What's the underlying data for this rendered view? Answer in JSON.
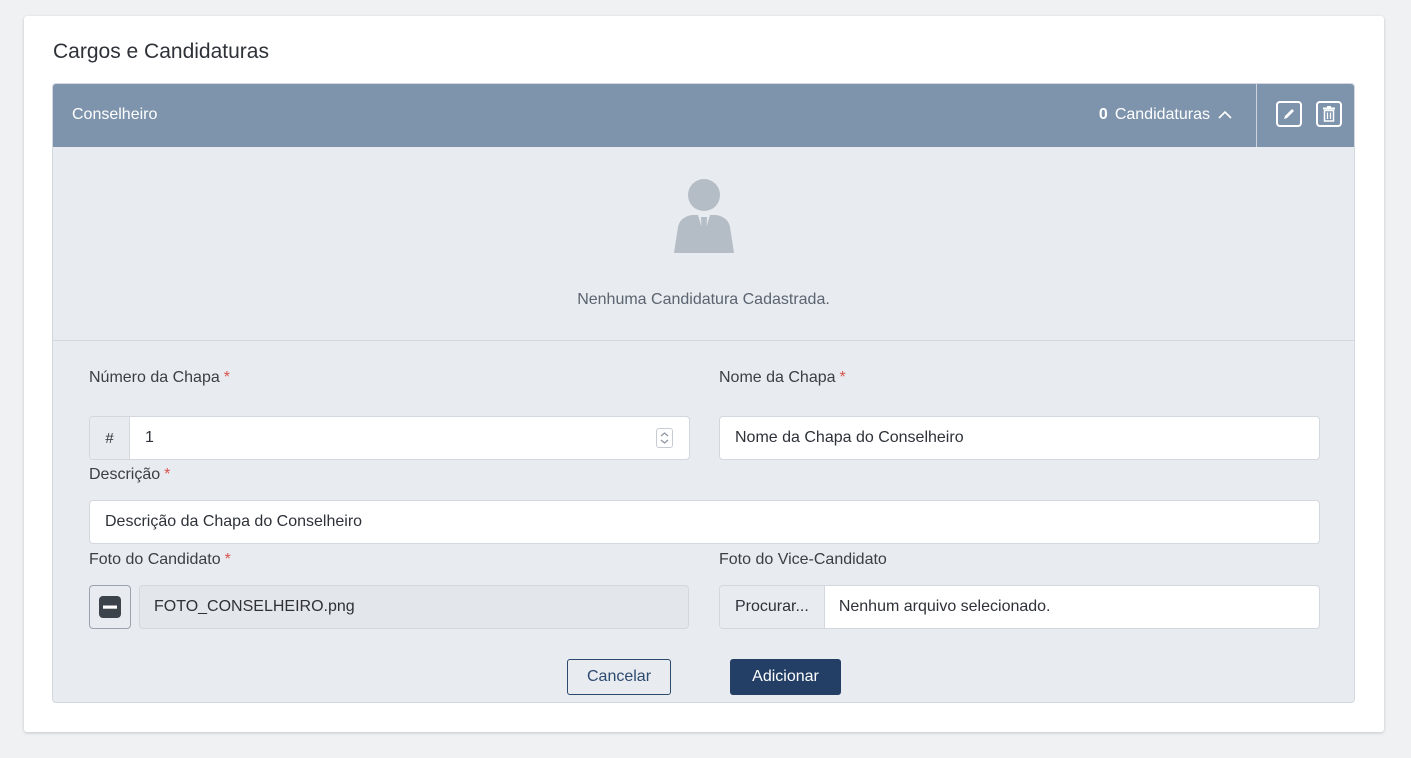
{
  "section": {
    "title": "Cargos e Candidaturas"
  },
  "cargo": {
    "name": "Conselheiro",
    "count": "0",
    "count_label": "Candidaturas",
    "empty_message": "Nenhuma Candidatura Cadastrada."
  },
  "form": {
    "numero": {
      "label": "Número da Chapa",
      "required": "*",
      "prefix": "#",
      "value": "1"
    },
    "nome": {
      "label": "Nome da Chapa",
      "required": "*",
      "value": "Nome da Chapa do Conselheiro"
    },
    "descricao": {
      "label": "Descrição",
      "required": "*",
      "value": "Descrição da Chapa do Conselheiro"
    },
    "foto_candidato": {
      "label": "Foto do Candidato",
      "required": "*",
      "file_name": "FOTO_CONSELHEIRO.png"
    },
    "foto_vice": {
      "label": "Foto do Vice-Candidato",
      "browse_label": "Procurar...",
      "file_status": "Nenhum arquivo selecionado."
    }
  },
  "actions": {
    "cancel": "Cancelar",
    "add": "Adicionar"
  },
  "colors": {
    "header_bg": "#7e94ac",
    "primary": "#243f66",
    "required": "#d9534f",
    "panel_bg": "#e8ebef"
  },
  "icons": [
    "chevron-up-icon",
    "edit-icon",
    "trash-icon",
    "person-icon",
    "minus-icon",
    "spinner-icon"
  ]
}
